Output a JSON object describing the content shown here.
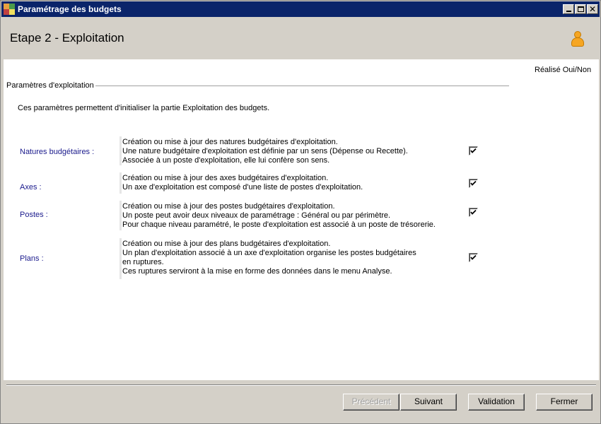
{
  "window": {
    "title": "Paramétrage des budgets"
  },
  "header": {
    "step_title": "Etape 2 - Exploitation"
  },
  "content": {
    "done_column_header": "Réalisé Oui/Non",
    "group_label": "Paramètres d'exploitation",
    "intro": "Ces paramètres permettent d'initialiser la partie Exploitation des budgets.",
    "rows": [
      {
        "label": "Natures budgétaires :",
        "lines": [
          "Création ou mise à jour des natures budgétaires d'exploitation.",
          "Une nature budgétaire d'exploitation est définie par un sens (Dépense ou Recette).",
          "Associée à un poste d'exploitation, elle lui confère son sens."
        ],
        "checked": true
      },
      {
        "label": "Axes :",
        "lines": [
          "Création ou mise à jour des axes budgétaires d'exploitation.",
          "Un axe d'exploitation est composé d'une liste de postes d'exploitation."
        ],
        "checked": true
      },
      {
        "label": "Postes :",
        "lines": [
          "Création ou mise à jour des postes budgétaires d'exploitation.",
          "Un poste peut avoir deux niveaux de paramétrage : Général ou par périmètre.",
          "Pour chaque niveau paramétré, le poste d'exploitation est associé à un poste de trésorerie."
        ],
        "checked": true
      },
      {
        "label": "Plans :",
        "lines": [
          "Création ou mise à jour des plans budgétaires d'exploitation.",
          "Un plan d'exploitation associé à un axe d'exploitation organise les postes budgétaires",
          "en ruptures.",
          "Ces ruptures serviront à la mise en forme des données dans le menu Analyse."
        ],
        "checked": true
      }
    ]
  },
  "footer": {
    "previous": "Précédent",
    "next": "Suivant",
    "validate": "Validation",
    "close": "Fermer"
  }
}
